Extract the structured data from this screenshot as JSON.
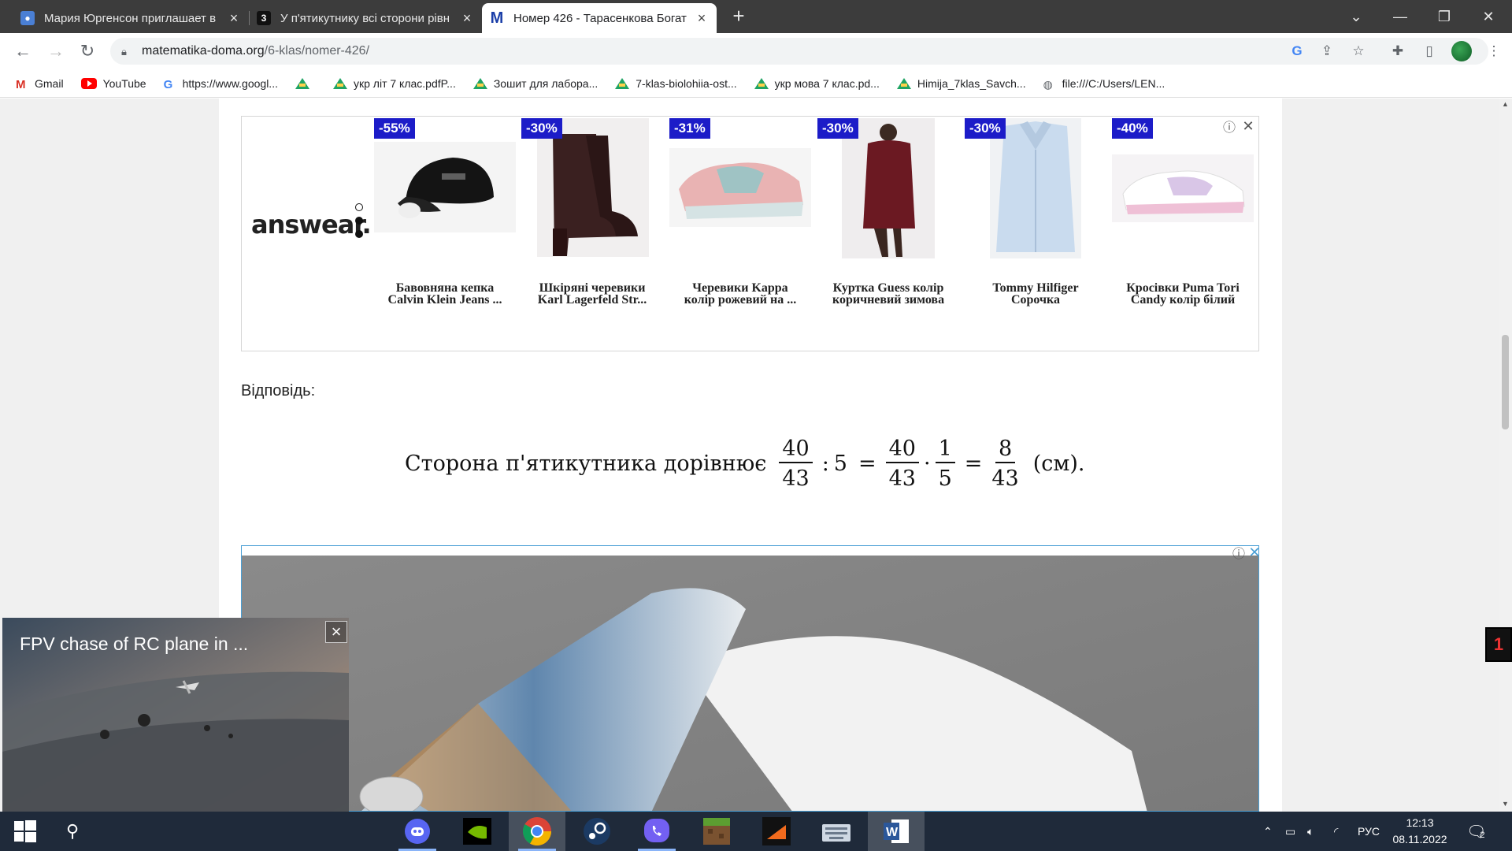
{
  "tabs": [
    {
      "title": "Мария Юргенсон приглашает в",
      "favicon": "contact-icon"
    },
    {
      "title": "У п'ятикутнику всі сторони рівн",
      "favicon": "3"
    },
    {
      "title": "Номер 426 - Тарасенкова Богат",
      "favicon": "M"
    }
  ],
  "url": {
    "host": "matematika-doma.org",
    "path": "/6-klas/nomer-426/"
  },
  "bookmarks": [
    {
      "label": "Gmail",
      "icon": "gmail-icon"
    },
    {
      "label": "YouTube",
      "icon": "youtube-icon"
    },
    {
      "label": "https://www.googl...",
      "icon": "google-icon"
    },
    {
      "label": "",
      "icon": "drive-icon"
    },
    {
      "label": "укр літ 7 клас.pdfP...",
      "icon": "drive-icon"
    },
    {
      "label": "Зошит для лабора...",
      "icon": "drive-icon"
    },
    {
      "label": "7-klas-biolohiia-ost...",
      "icon": "drive-icon"
    },
    {
      "label": "укр мова 7 клас.pd...",
      "icon": "drive-icon"
    },
    {
      "label": "Himija_7klas_Savch...",
      "icon": "drive-icon"
    },
    {
      "label": "file:///C:/Users/LEN...",
      "icon": "globe-icon"
    }
  ],
  "ad1": {
    "brand": "answear.",
    "products": [
      {
        "discount": "-55%",
        "name_line1": "Бавовняна кепка",
        "name_line2": "Calvin Klein Jeans ...",
        "color": "#111111"
      },
      {
        "discount": "-30%",
        "name_line1": "Шкіряні черевики",
        "name_line2": "Karl Lagerfeld Str...",
        "color": "#3b2323"
      },
      {
        "discount": "-31%",
        "name_line1": "Черевики Kappa",
        "name_line2": "колір рожевий на ...",
        "color": "#e9a9a9"
      },
      {
        "discount": "-30%",
        "name_line1": "Куртка Guess колір",
        "name_line2": "коричневий зимова",
        "color": "#6a1a22"
      },
      {
        "discount": "-30%",
        "name_line1": "Tommy Hilfiger",
        "name_line2": "Сорочка",
        "color": "#c7d9ec"
      },
      {
        "discount": "-40%",
        "name_line1": "Кросівки Puma Tori",
        "name_line2": "Candy колір білий",
        "color": "#f3f0f3"
      }
    ]
  },
  "answer": {
    "label": "Відповідь:",
    "text": "Сторона п'ятикутника дорівнює",
    "f1_num": "40",
    "f1_den": "43",
    "div": ":",
    "divisor": "5",
    "eq": "=",
    "f2_num": "40",
    "f2_den": "43",
    "dot": "·",
    "f3_num": "1",
    "f3_den": "5",
    "f4_num": "8",
    "f4_den": "43",
    "unit": "(см)."
  },
  "video": {
    "title": "FPV chase of RC plane in ..."
  },
  "side_widget": {
    "label": "1"
  },
  "taskbar": {
    "lang": "РУС",
    "time": "12:13",
    "date": "08.11.2022",
    "notifications": "2"
  }
}
